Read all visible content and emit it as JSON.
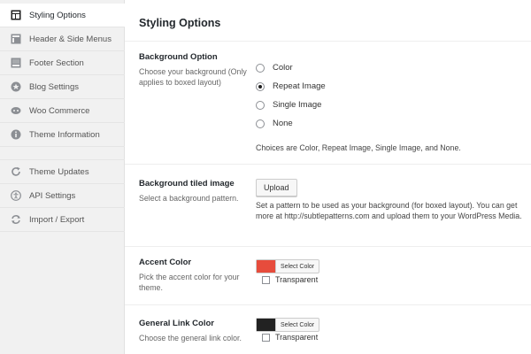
{
  "colors": {
    "accent_swatch": "#e74c3c",
    "link_swatch": "#222222",
    "primary": "#0073aa"
  },
  "sidebar": {
    "items": [
      {
        "label": "Styling Options",
        "icon": "styling-icon"
      },
      {
        "label": "Header & Side Menus",
        "icon": "header-icon"
      },
      {
        "label": "Footer Section",
        "icon": "footer-icon"
      },
      {
        "label": "Blog Settings",
        "icon": "star-icon"
      },
      {
        "label": "Woo Commerce",
        "icon": "woo-icon"
      },
      {
        "label": "Theme Information",
        "icon": "info-icon"
      },
      {
        "label": "Theme Updates",
        "icon": "refresh-icon"
      },
      {
        "label": "API Settings",
        "icon": "accessibility-icon"
      },
      {
        "label": "Import / Export",
        "icon": "sync-icon"
      }
    ]
  },
  "main": {
    "title": "Styling Options",
    "background_option": {
      "title": "Background Option",
      "desc": "Choose your background (Only applies to boxed layout)",
      "options": [
        "Color",
        "Repeat Image",
        "Single Image",
        "None"
      ],
      "selected": "Repeat Image",
      "help": "Choices are Color, Repeat Image, Single Image, and None."
    },
    "background_tiled": {
      "title": "Background tiled image",
      "desc": "Select a background pattern.",
      "button": "Upload",
      "help": "Set a pattern to be used as your background (for boxed layout). You can get more at http://subtlepatterns.com and upload them to your WordPress Media."
    },
    "accent_color": {
      "title": "Accent Color",
      "desc": "Pick the accent color for your theme.",
      "picker_label": "Select Color",
      "transparent_label": "Transparent"
    },
    "link_color": {
      "title": "General Link Color",
      "desc": "Choose the general link color.",
      "picker_label": "Select Color",
      "transparent_label": "Transparent"
    }
  }
}
